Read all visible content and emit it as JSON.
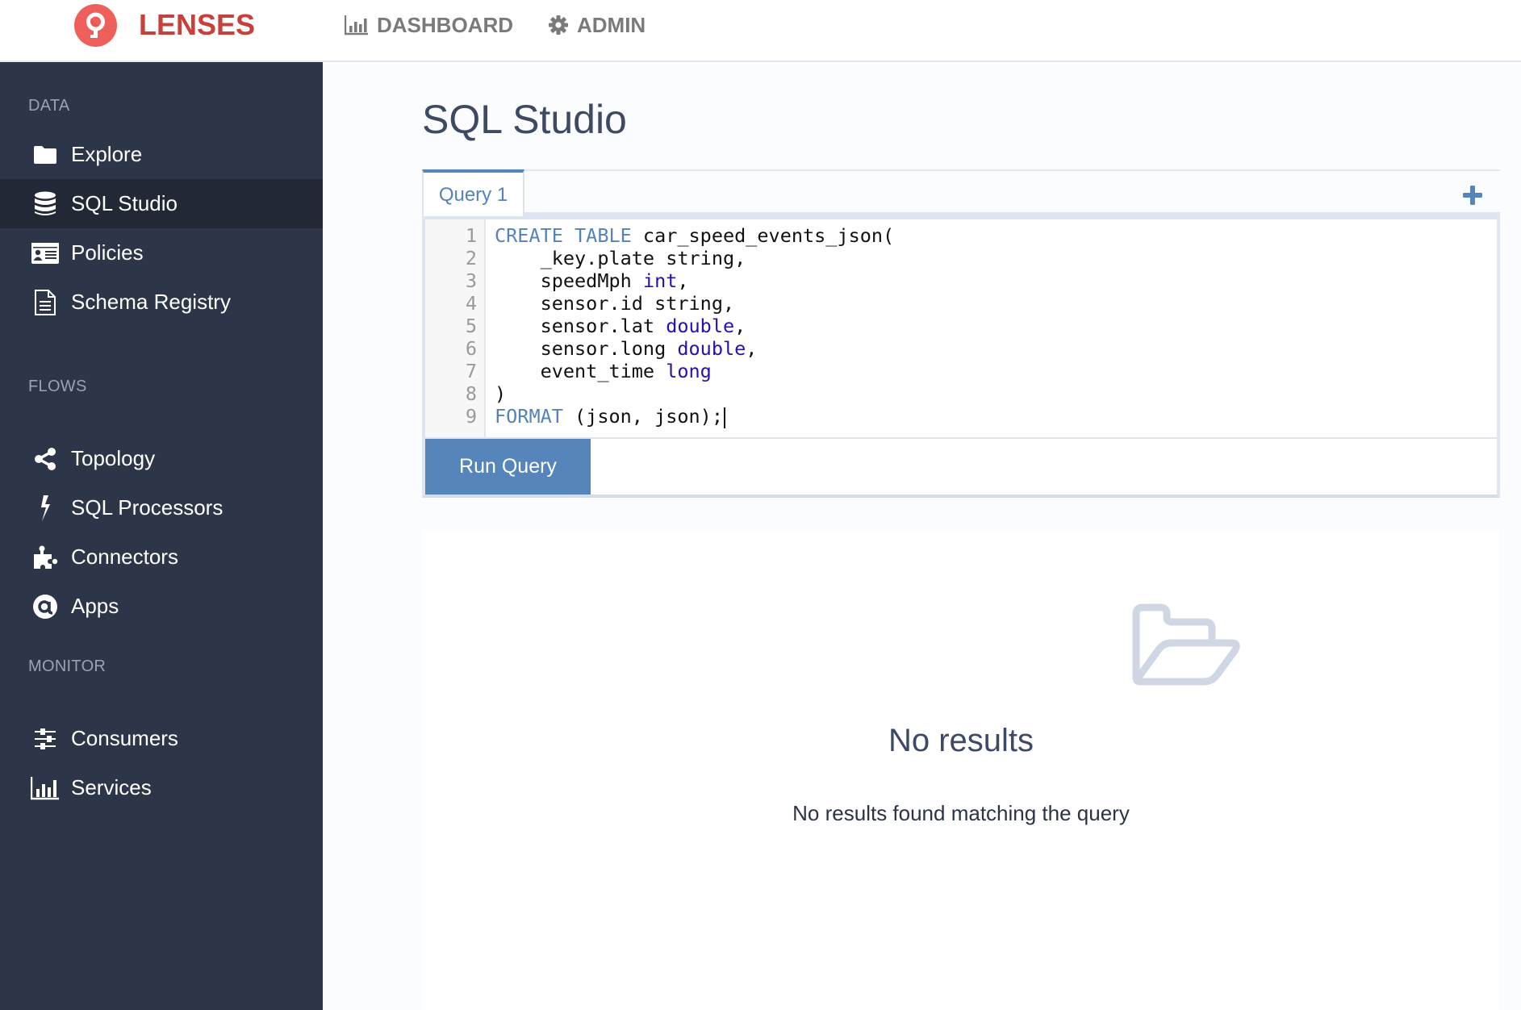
{
  "header": {
    "brand": "LENSES",
    "nav": [
      {
        "label": "DASHBOARD",
        "icon": "bar-chart-icon"
      },
      {
        "label": "ADMIN",
        "icon": "gear-icon"
      }
    ]
  },
  "sidebar": {
    "sections": [
      {
        "label": "DATA",
        "items": [
          {
            "label": "Explore",
            "icon": "folder-icon",
            "active": false
          },
          {
            "label": "SQL Studio",
            "icon": "database-icon",
            "active": true
          },
          {
            "label": "Policies",
            "icon": "id-card-icon",
            "active": false
          },
          {
            "label": "Schema Registry",
            "icon": "document-icon",
            "active": false
          }
        ]
      },
      {
        "label": "FLOWS",
        "items": [
          {
            "label": "Topology",
            "icon": "share-icon",
            "active": false
          },
          {
            "label": "SQL Processors",
            "icon": "lightning-icon",
            "active": false
          },
          {
            "label": "Connectors",
            "icon": "puzzle-icon",
            "active": false
          },
          {
            "label": "Apps",
            "icon": "at-icon",
            "active": false
          }
        ]
      },
      {
        "label": "MONITOR",
        "items": [
          {
            "label": "Consumers",
            "icon": "sliders-icon",
            "active": false
          },
          {
            "label": "Services",
            "icon": "bar-chart-icon",
            "active": false
          }
        ]
      }
    ]
  },
  "main": {
    "title": "SQL Studio",
    "tabs": [
      {
        "label": "Query 1",
        "active": true
      }
    ],
    "add_tab_icon": "plus-icon",
    "editor": {
      "line_numbers": [
        "1",
        "2",
        "3",
        "4",
        "5",
        "6",
        "7",
        "8",
        "9"
      ],
      "lines": [
        [
          {
            "t": "CREATE TABLE",
            "c": "kw"
          },
          {
            "t": " car_speed_events_json(",
            "c": ""
          }
        ],
        [
          {
            "t": "    _key.plate string,",
            "c": ""
          }
        ],
        [
          {
            "t": "    speedMph ",
            "c": ""
          },
          {
            "t": "int",
            "c": "ty"
          },
          {
            "t": ",",
            "c": ""
          }
        ],
        [
          {
            "t": "    sensor.id string,",
            "c": ""
          }
        ],
        [
          {
            "t": "    sensor.lat ",
            "c": ""
          },
          {
            "t": "double",
            "c": "ty"
          },
          {
            "t": ",",
            "c": ""
          }
        ],
        [
          {
            "t": "    sensor.long ",
            "c": ""
          },
          {
            "t": "double",
            "c": "ty"
          },
          {
            "t": ",",
            "c": ""
          }
        ],
        [
          {
            "t": "    event_time ",
            "c": ""
          },
          {
            "t": "long",
            "c": "ty"
          }
        ],
        [
          {
            "t": ")",
            "c": ""
          }
        ],
        [
          {
            "t": "FORMAT",
            "c": "kw"
          },
          {
            "t": " (json, json);",
            "c": ""
          }
        ]
      ]
    },
    "run_button": "Run Query",
    "results": {
      "icon": "folder-open-icon",
      "title": "No results",
      "subtitle": "No results found matching the query"
    }
  },
  "colors": {
    "brand": "#c9403b",
    "logo": "#ee5f5b",
    "accent": "#5585bb",
    "sidebar_bg": "#2d3548",
    "sidebar_active": "#222836",
    "keyword": "#5383b8",
    "type": "#2a0eb0"
  }
}
